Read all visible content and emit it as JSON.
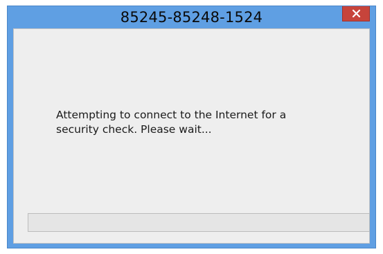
{
  "window": {
    "title": "85245-85248-1524",
    "close_symbol": "×",
    "accent_color": "#5f9fe3",
    "close_button_color": "#c7443b"
  },
  "dialog": {
    "message_line1": "Attempting to connect to the Internet for a",
    "message_line2": "security check. Please wait..."
  },
  "progress": {
    "value_percent": 0
  },
  "icons": {
    "close": "close-icon"
  }
}
